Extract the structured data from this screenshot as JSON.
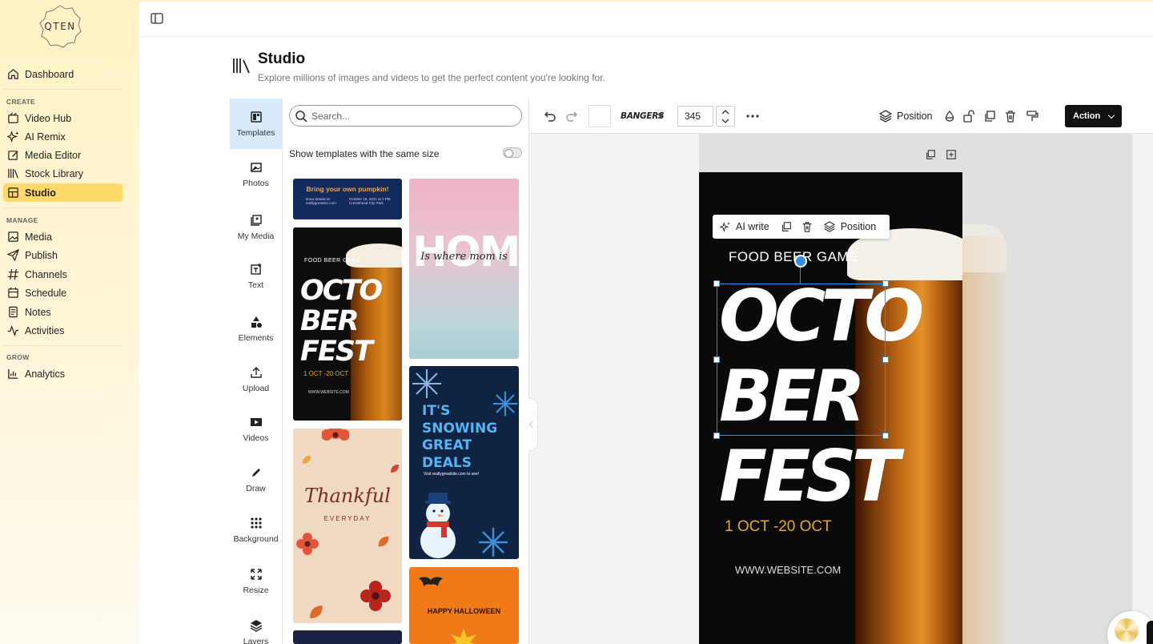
{
  "brand": {
    "logo_text": "QTEN"
  },
  "sidebar": {
    "dashboard": "Dashboard",
    "sections": {
      "create": "CREATE",
      "manage": "MANAGE",
      "grow": "GROW"
    },
    "create_items": [
      {
        "label": "Video Hub",
        "icon": "video-icon"
      },
      {
        "label": "AI Remix",
        "icon": "sparkle-icon"
      },
      {
        "label": "Media Editor",
        "icon": "edit-icon"
      },
      {
        "label": "Stock Library",
        "icon": "library-icon"
      },
      {
        "label": "Studio",
        "icon": "studio-icon",
        "active": true
      }
    ],
    "manage_items": [
      {
        "label": "Media",
        "icon": "image-icon"
      },
      {
        "label": "Publish",
        "icon": "send-icon"
      },
      {
        "label": "Channels",
        "icon": "hash-icon"
      },
      {
        "label": "Schedule",
        "icon": "calendar-icon"
      },
      {
        "label": "Notes",
        "icon": "notes-icon"
      },
      {
        "label": "Activities",
        "icon": "activity-icon"
      }
    ],
    "grow_items": [
      {
        "label": "Analytics",
        "icon": "chart-icon"
      }
    ]
  },
  "header": {
    "title": "Studio",
    "subtitle": "Explore millions of images and videos to get the perfect content you're looking for."
  },
  "rail": {
    "items": [
      "Templates",
      "Photos",
      "My Media",
      "Text",
      "Elements",
      "Upload",
      "Videos",
      "Draw",
      "Background",
      "Resize",
      "Layers"
    ]
  },
  "panel": {
    "search_placeholder": "Search...",
    "same_size_label": "Show templates with the same size",
    "same_size_enabled": false,
    "templates": {
      "pumpkin": {
        "title": "Bring your own pumpkin!",
        "left": "know details at reallygreatsite.com",
        "right": "October 18, 2021 at 3 PM Crestehead City Park"
      },
      "octoberfest": {
        "top": "FOOD  BEER  GAME",
        "big_1": "OCTO",
        "big_2": "BER",
        "big_3": "FEST",
        "date": "1 OCT -20 OCT",
        "web": "WWW.WEBSITE.COM"
      },
      "home": {
        "big": "HOME",
        "script": "Is where mom is"
      },
      "snowing": {
        "line_1": "IT'S",
        "line_2": "SNOWING",
        "line_3": "GREAT",
        "line_4": "DEALS",
        "sub": "Visit reallygreatsite.com to see!"
      },
      "thankful": {
        "title": "Thankful",
        "sub": "EVERYDAY"
      },
      "halloween": {
        "title": "HAPPY HALLOWEEN"
      }
    }
  },
  "toolbar": {
    "font_name": "BANGERS",
    "font_size": "345",
    "position_label": "Position",
    "action_label": "Action"
  },
  "design": {
    "top": "FOOD  BEER  GAME",
    "big_1": "OCTO",
    "big_2": "BER",
    "big_3": "FEST",
    "date": "1 OCT -20 OCT",
    "web": "WWW.WEBSITE.COM"
  },
  "float_bar": {
    "ai_write": "AI write",
    "position": "Position"
  },
  "colors": {
    "accent": "#ffd96a",
    "selection": "#3a8fd9",
    "rail_active": "#d9ebfa"
  }
}
